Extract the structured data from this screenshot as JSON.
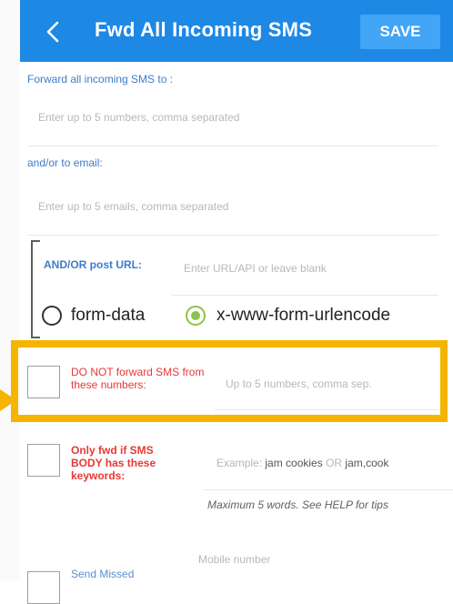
{
  "header": {
    "back_icon": "chevron-left-icon",
    "title": "Fwd All Incoming SMS",
    "save_label": "SAVE"
  },
  "forward_numbers": {
    "label": "Forward all incoming SMS to :",
    "placeholder": "Enter up to 5 numbers, comma separated"
  },
  "forward_email": {
    "label": "and/or to email:",
    "placeholder": "Enter up to 5 emails, comma separated"
  },
  "post_url": {
    "label": "AND/OR post URL:",
    "placeholder": "Enter URL/API or leave blank",
    "options": [
      {
        "label": "form-data",
        "selected": false
      },
      {
        "label": "x-www-form-urlencode",
        "selected": true
      }
    ]
  },
  "do_not_forward": {
    "label": "DO NOT forward SMS from these numbers:",
    "placeholder": "Up to 5 numbers, comma sep."
  },
  "keywords": {
    "label": "Only fwd if SMS BODY has these keywords:",
    "placeholder_prefix": "Example:",
    "placeholder_example1": "jam cookies",
    "placeholder_or": "OR",
    "placeholder_example2": "jam,cook",
    "help": "Maximum 5 words. See HELP for tips"
  },
  "missed_calls": {
    "label": "Send Missed",
    "placeholder": "Mobile number"
  },
  "colors": {
    "header": "#1e88e5",
    "save_button": "#42a5f5",
    "highlight": "#f5b400",
    "red_label": "#e53935",
    "blue_label": "#3d7dc8",
    "radio_selected": "#8bc34a"
  }
}
